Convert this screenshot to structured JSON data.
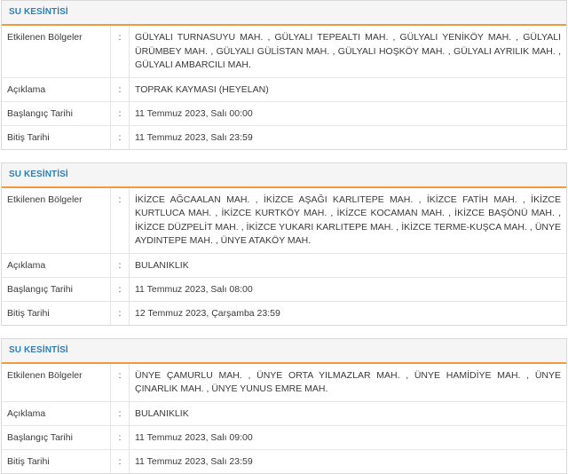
{
  "labels": {
    "affected": "Etkilenen Bölgeler",
    "description": "Açıklama",
    "start": "Başlangıç Tarihi",
    "end": "Bitiş Tarihi",
    "colon": ":"
  },
  "outages": [
    {
      "title": "SU KESİNTİSİ",
      "affected": "GÜLYALI TURNASUYU MAH. , GÜLYALI TEPEALTI MAH. , GÜLYALI YENİKÖY MAH. , GÜLYALI ÜRÜMBEY MAH. , GÜLYALI GÜLİSTAN MAH. , GÜLYALI HOŞKÖY MAH. , GÜLYALI AYRILIK MAH. , GÜLYALI AMBARCILI MAH.",
      "description": "TOPRAK KAYMASI (HEYELAN)",
      "start": "11 Temmuz 2023, Salı 00:00",
      "end": "11 Temmuz 2023, Salı 23:59"
    },
    {
      "title": "SU KESİNTİSİ",
      "affected": "İKİZCE AĞCAALAN MAH. , İKİZCE AŞAĞI KARLITEPE MAH. , İKİZCE FATİH MAH. , İKİZCE KURTLUCA MAH. , İKİZCE KURTKÖY MAH. , İKİZCE KOCAMAN MAH. , İKİZCE BAŞÖNÜ MAH. , İKİZCE DÜZPELİT MAH. , İKİZCE YUKARI KARLITEPE MAH. , İKİZCE TERME-KUŞCA MAH. , ÜNYE AYDINTEPE MAH. , ÜNYE ATAKÖY MAH.",
      "description": "BULANIKLIK",
      "start": "11 Temmuz 2023, Salı 08:00",
      "end": "12 Temmuz 2023, Çarşamba 23:59"
    },
    {
      "title": "SU KESİNTİSİ",
      "affected": "ÜNYE ÇAMURLU MAH. , ÜNYE ORTA YILMAZLAR MAH. , ÜNYE HAMİDİYE MAH. , ÜNYE ÇINARLIK MAH. , ÜNYE YUNUS EMRE MAH.",
      "description": "BULANIKLIK",
      "start": "11 Temmuz 2023, Salı 09:00",
      "end": "11 Temmuz 2023, Salı 23:59"
    }
  ],
  "colors": {
    "title": "#2f7fb5",
    "accent": "#f59a3c",
    "header_bg": "#f5f5f5",
    "border": "#e5e5e5",
    "text": "#3a3a3a"
  }
}
